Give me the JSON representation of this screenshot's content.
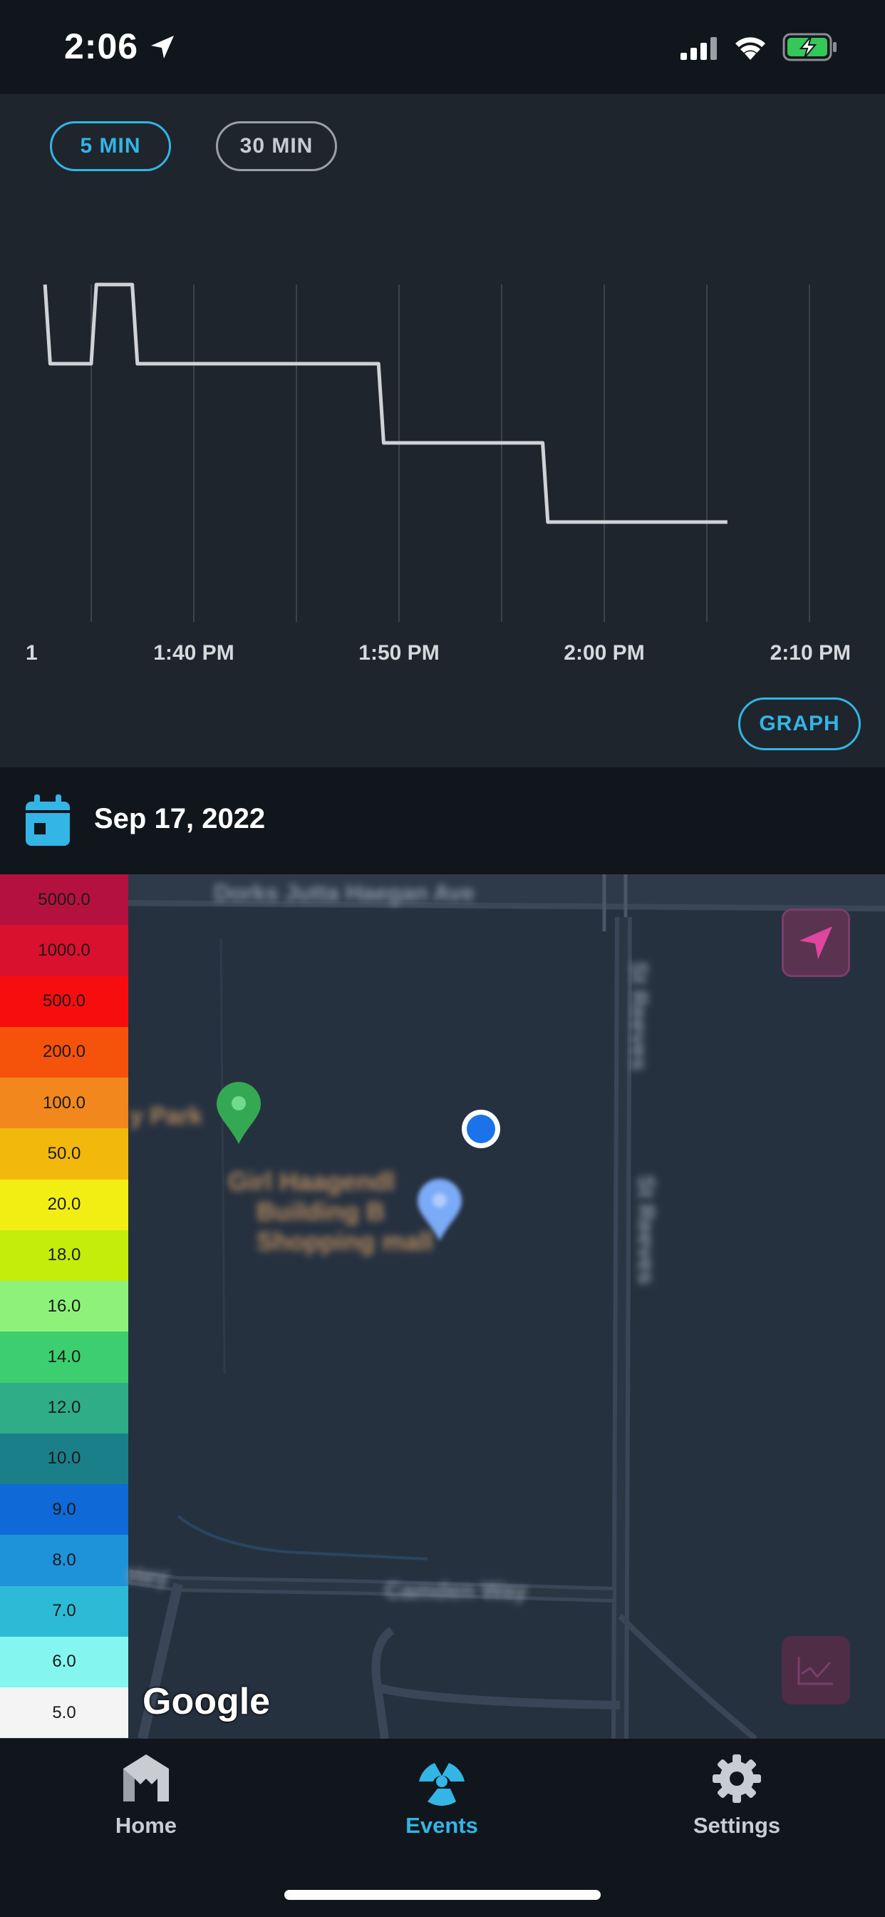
{
  "status_bar": {
    "time": "2:06"
  },
  "range_toggle": {
    "five_min": "5 MIN",
    "thirty_min": "30 MIN"
  },
  "chart_data": {
    "type": "line",
    "title": "",
    "xlabel": "",
    "ylabel": "",
    "x_ticks": [
      "1",
      "1:40 PM",
      "1:50 PM",
      "2:00 PM",
      "2:10 PM"
    ],
    "grid": "vertical",
    "series": [
      {
        "values": [
          [
            "1:32:45 PM",
            4
          ],
          [
            "1:33:00 PM",
            3
          ],
          [
            "1:35:00 PM",
            3
          ],
          [
            "1:35:15 PM",
            4
          ],
          [
            "1:37:00 PM",
            4
          ],
          [
            "1:37:15 PM",
            3
          ],
          [
            "1:49:00 PM",
            3
          ],
          [
            "1:49:15 PM",
            2
          ],
          [
            "1:57:00 PM",
            2
          ],
          [
            "1:57:15 PM",
            1
          ],
          [
            "2:06:00 PM",
            1
          ]
        ]
      }
    ]
  },
  "graph_button": "GRAPH",
  "date_bar": {
    "date": "Sep 17, 2022"
  },
  "map": {
    "legend": [
      {
        "value": "5000.0",
        "color": "#b5113f"
      },
      {
        "value": "1000.0",
        "color": "#d9102e"
      },
      {
        "value": "500.0",
        "color": "#f70d0d"
      },
      {
        "value": "200.0",
        "color": "#f5520c"
      },
      {
        "value": "100.0",
        "color": "#f2871d"
      },
      {
        "value": "50.0",
        "color": "#f2b90c"
      },
      {
        "value": "20.0",
        "color": "#f2ee14"
      },
      {
        "value": "18.0",
        "color": "#c4ed0c"
      },
      {
        "value": "16.0",
        "color": "#8ef27a"
      },
      {
        "value": "14.0",
        "color": "#3dcf6f"
      },
      {
        "value": "12.0",
        "color": "#2ead86"
      },
      {
        "value": "10.0",
        "color": "#1b7f8a"
      },
      {
        "value": "9.0",
        "color": "#0f69d6"
      },
      {
        "value": "8.0",
        "color": "#1e93d9"
      },
      {
        "value": "7.0",
        "color": "#2dbad6"
      },
      {
        "value": "6.0",
        "color": "#84f6ef"
      },
      {
        "value": "5.0",
        "color": "#f4f4f4"
      }
    ],
    "attribution": "Google"
  },
  "tab_bar": {
    "home": "Home",
    "events": "Events",
    "settings": "Settings"
  },
  "colors": {
    "accent": "#33b5e5",
    "background": "#1e252d",
    "bar": "#11161c",
    "map": "#263140"
  }
}
